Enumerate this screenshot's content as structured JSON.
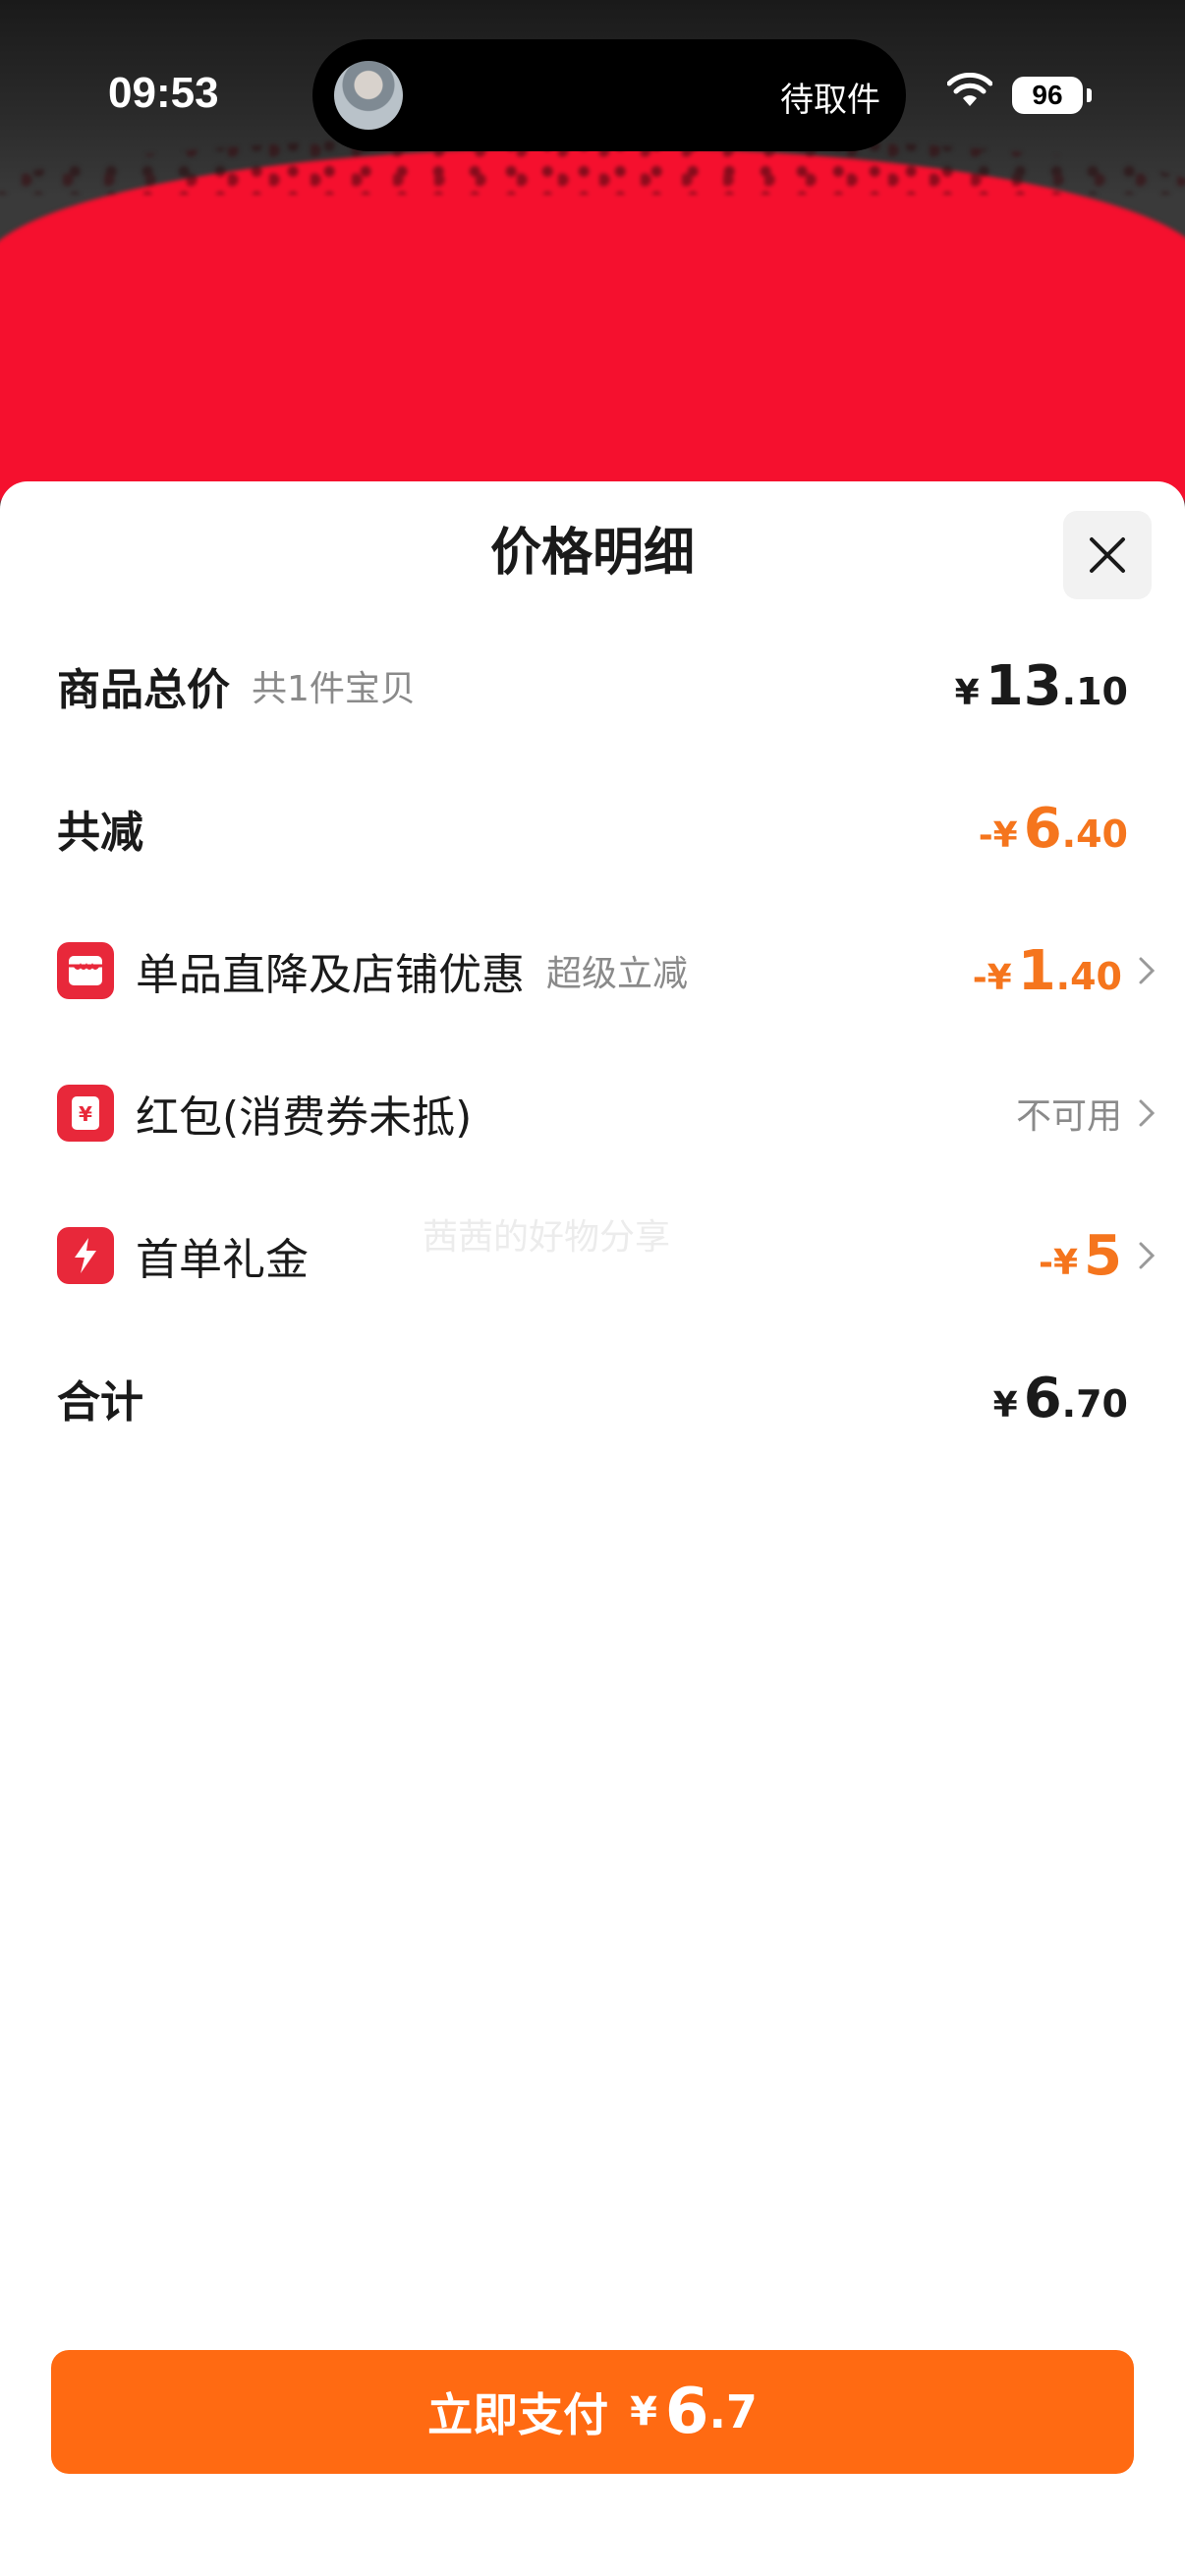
{
  "status_bar": {
    "time": "09:53",
    "island_text": "待取件",
    "battery": "96",
    "icons": [
      "avatar",
      "wifi-icon",
      "battery-icon"
    ]
  },
  "sheet": {
    "title": "价格明细",
    "close_icon": "close-icon"
  },
  "rows": {
    "subtotal": {
      "label": "商品总价",
      "sub": "共1件宝贝",
      "prefix": "¥",
      "int": "13",
      "dec": ".10"
    },
    "discount_total": {
      "label": "共减",
      "prefix": "-¥",
      "int": "6",
      "dec": ".40"
    },
    "shop_discount": {
      "label": "单品直降及店铺优惠",
      "sub": "超级立减",
      "prefix": "-¥",
      "int": "1",
      "dec": ".40",
      "icon": "shop-icon"
    },
    "red_packet": {
      "label": "红包(消费券未抵)",
      "status": "不可用",
      "icon": "red-packet-icon"
    },
    "first_order": {
      "label": "首单礼金",
      "prefix": "-¥",
      "int": "5",
      "icon": "lightning-icon"
    },
    "total": {
      "label": "合计",
      "prefix": "¥",
      "int": "6",
      "dec": ".70"
    }
  },
  "watermark": "茜茜的好物分享",
  "pay_button": {
    "label": "立即支付",
    "prefix": "¥",
    "int": "6",
    "dec": ".7"
  },
  "colors": {
    "accent": "#ff6a12",
    "discount": "#f5751d",
    "icon_red": "#e8283a"
  }
}
